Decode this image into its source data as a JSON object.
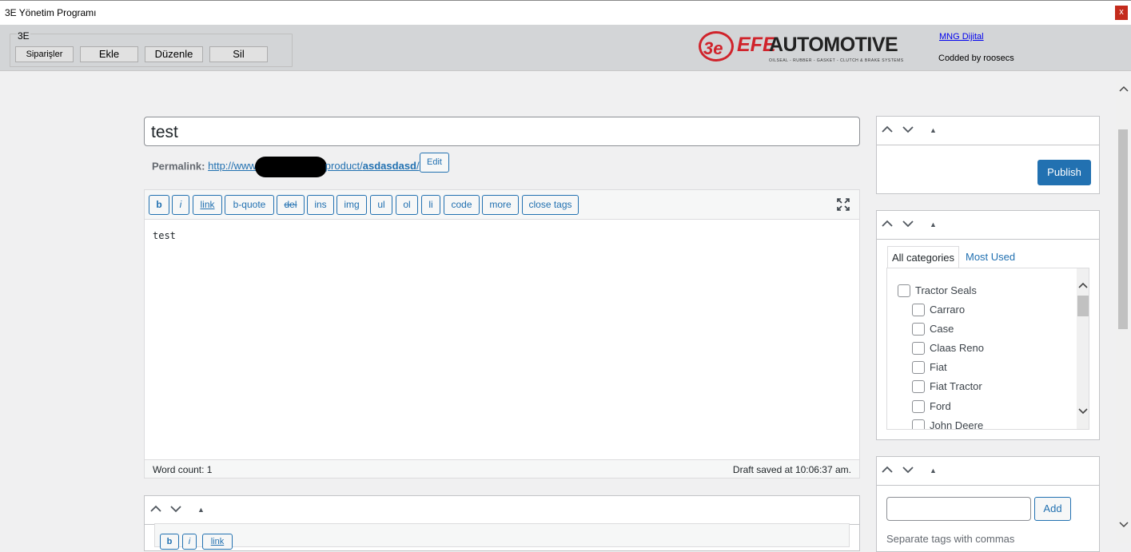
{
  "window": {
    "title": "3E Yönetim Programı",
    "close_label": "x"
  },
  "appbar": {
    "group_label": "3E",
    "buttons": [
      "Siparişler",
      "Ekle",
      "Düzenle",
      "Sil"
    ],
    "logo": {
      "mark": "3e",
      "efe": "EFE",
      "automotive": "AUTOMOTIVE",
      "tagline": "OILSEAL - RUBBER - GASKET - CLUTCH & BRAKE SYSTEMS"
    },
    "link": "MNG Dijital",
    "credit": "Codded by roosecs"
  },
  "post": {
    "title": "test",
    "permalink_label": "Permalink:",
    "permalink_prefix": "http://www",
    "permalink_path": "product/",
    "permalink_slug": "asdasdasd",
    "permalink_suffix": "/",
    "edit_label": "Edit"
  },
  "editor": {
    "buttons": [
      "b",
      "i",
      "link",
      "b-quote",
      "del",
      "ins",
      "img",
      "ul",
      "ol",
      "li",
      "code",
      "more",
      "close tags"
    ],
    "content": "test",
    "word_count": "Word count: 1",
    "draft_status": "Draft saved at 10:06:37 am."
  },
  "publish_box": {
    "publish_label": "Publish"
  },
  "categories_box": {
    "tabs": [
      "All categories",
      "Most Used"
    ],
    "items": [
      "Tractor Seals",
      "Carraro",
      "Case",
      "Claas Reno",
      "Fiat",
      "Fiat Tractor",
      "Ford",
      "John Deere"
    ]
  },
  "tags_box": {
    "add_label": "Add",
    "hint": "Separate tags with commas"
  },
  "bottom_box": {
    "buttons": [
      "b",
      "i",
      "link"
    ]
  },
  "icons": {
    "up": "▲",
    "chev_up": "^",
    "chev_down": "v"
  }
}
